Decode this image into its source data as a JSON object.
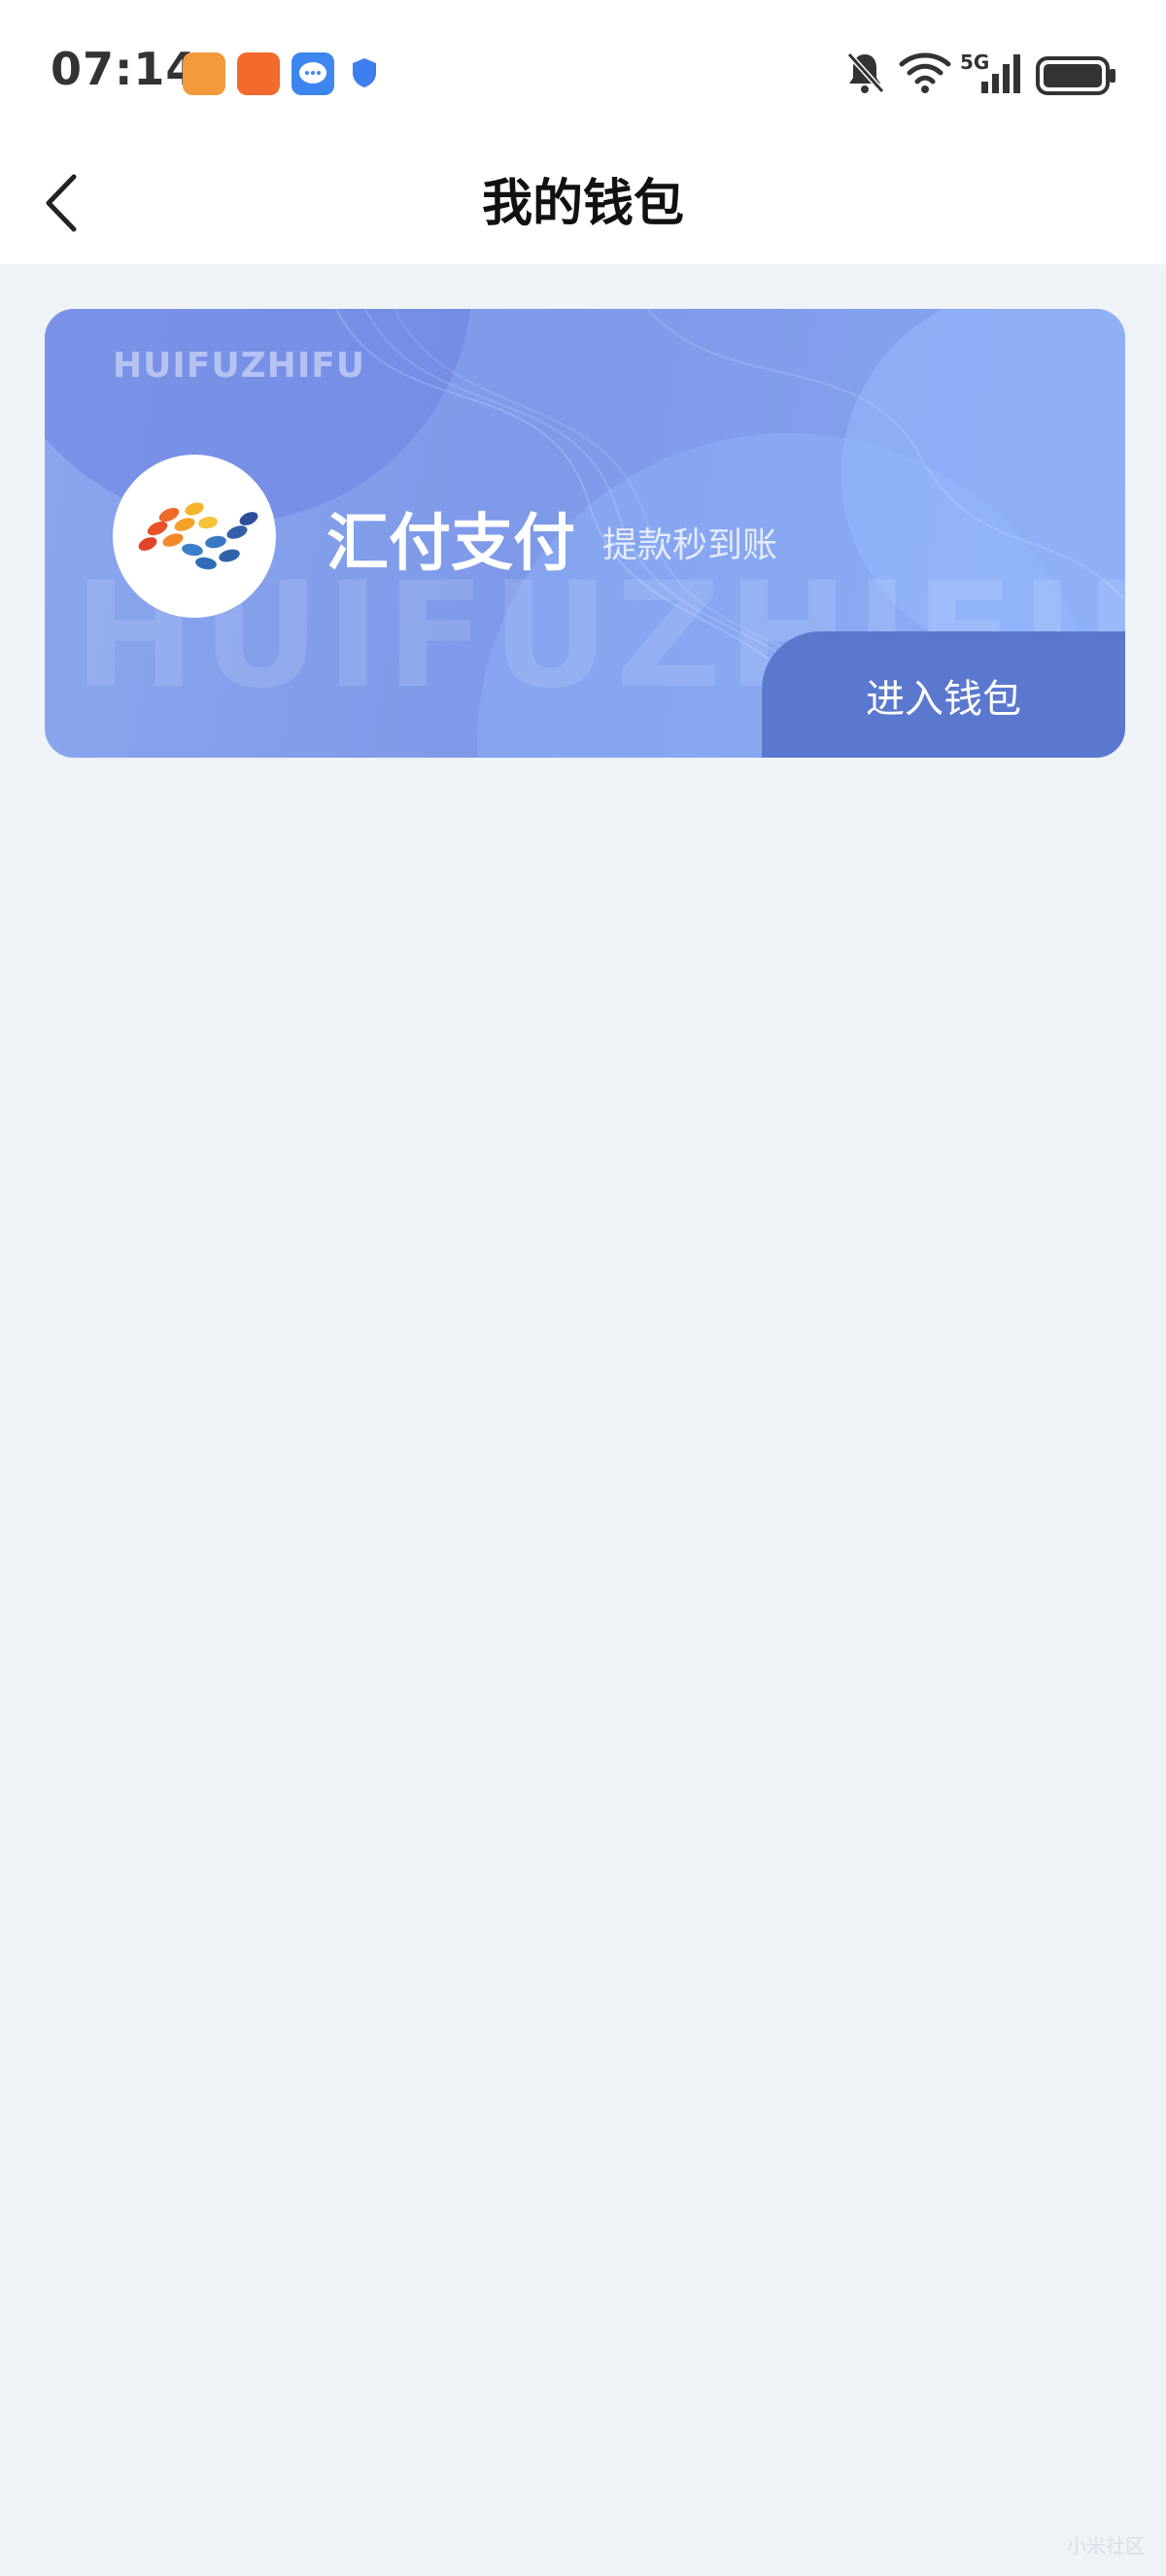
{
  "status_bar": {
    "time": "07:14",
    "icons": [
      "app-icon-orange",
      "app-icon-kuaishou",
      "app-icon-chat",
      "shield-icon",
      "bell-off-icon",
      "wifi-icon",
      "5g-signal-icon",
      "battery-icon"
    ],
    "network": "5G"
  },
  "header": {
    "title": "我的钱包",
    "back_icon": "chevron-left-icon"
  },
  "wallet_card": {
    "brand_small": "HUIFUZHIFU",
    "watermark": "HUIFUZHIFU",
    "name": "汇付支付",
    "slogan": "提款秒到账",
    "enter_button": "进入钱包",
    "colors": {
      "card_bg": "#7e99e8",
      "button_bg": "#5b78cf"
    }
  },
  "footer": {
    "corner_mark": "小米社区"
  },
  "colors": {
    "page_bg": "#eff3f8",
    "header_bg": "#ffffff"
  }
}
